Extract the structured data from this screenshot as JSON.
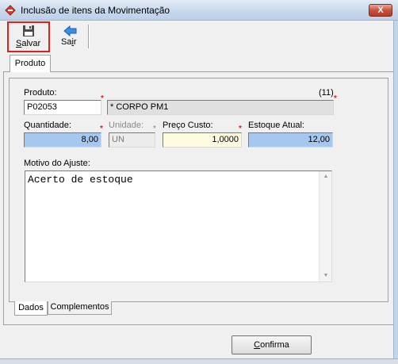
{
  "window": {
    "title": "Inclusão de itens da Movimentação",
    "close_glyph": "X"
  },
  "toolbar": {
    "save_label_first": "S",
    "save_label_rest": "alvar",
    "exit_label_first": "Sa",
    "exit_label_under": "i",
    "exit_label_rest": "r"
  },
  "tabs": {
    "outer": "Produto",
    "bottom": [
      "Dados",
      "Complementos"
    ]
  },
  "form": {
    "produto_label": "Produto:",
    "produto_code": "P02053",
    "produto_desc": "* CORPO PM1",
    "produto_count": "(11)",
    "quantidade_label": "Quantidade:",
    "quantidade_value": "8,00",
    "unidade_label": "Unidade:",
    "unidade_value": "UN",
    "preco_label": "Preço Custo:",
    "preco_value": "1,0000",
    "estoque_label": "Estoque Atual:",
    "estoque_value": "12,00",
    "motivo_label": "Motivo do Ajuste:",
    "motivo_value": "Acerto de estoque"
  },
  "confirm": {
    "first": "C",
    "rest": "onfirma"
  },
  "colors": {
    "highlight": "#e02020",
    "blue_field": "#a6c8ee",
    "yellow_field": "#fffbe1"
  }
}
